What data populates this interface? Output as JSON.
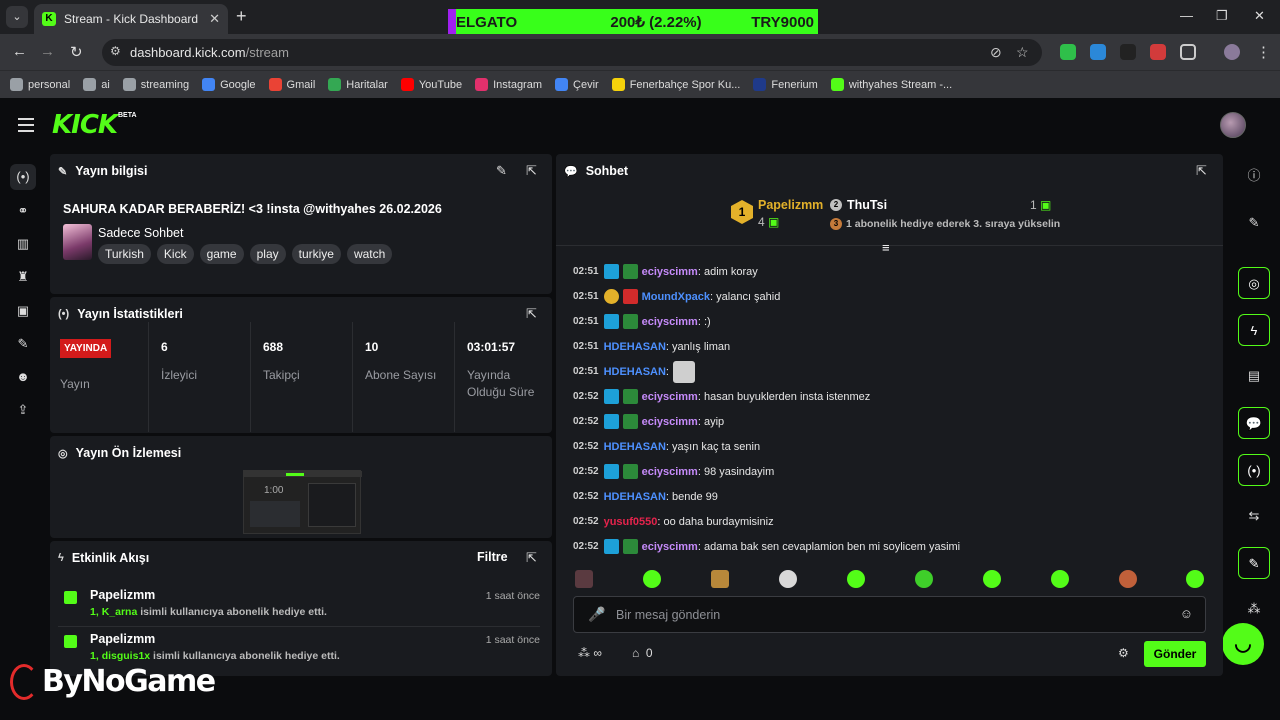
{
  "browser": {
    "tab_title": "Stream - Kick Dashboard",
    "url_host": "dashboard.kick.com",
    "url_path": "/stream",
    "ticker": {
      "left": "ELGATO",
      "mid": "200₺ (2.22%)",
      "right": "TRY9000"
    },
    "bookmarks": [
      {
        "label": "personal",
        "icon": "folder-icon",
        "color": "#9aa0a6"
      },
      {
        "label": "ai",
        "icon": "folder-icon",
        "color": "#9aa0a6"
      },
      {
        "label": "streaming",
        "icon": "folder-icon",
        "color": "#9aa0a6"
      },
      {
        "label": "Google",
        "icon": "google-icon",
        "color": "#4285f4"
      },
      {
        "label": "Gmail",
        "icon": "gmail-icon",
        "color": "#ea4335"
      },
      {
        "label": "Haritalar",
        "icon": "maps-icon",
        "color": "#34a853"
      },
      {
        "label": "YouTube",
        "icon": "youtube-icon",
        "color": "#ff0000"
      },
      {
        "label": "Instagram",
        "icon": "instagram-icon",
        "color": "#e1306c"
      },
      {
        "label": "Çevir",
        "icon": "translate-icon",
        "color": "#4285f4"
      },
      {
        "label": "Fenerbahçe Spor Ku...",
        "icon": "fenerbahce-icon",
        "color": "#f5d20b"
      },
      {
        "label": "Fenerium",
        "icon": "fenerium-icon",
        "color": "#1f3a8a"
      },
      {
        "label": "withyahes Stream -...",
        "icon": "kick-icon",
        "color": "#53fc18"
      }
    ]
  },
  "kick": {
    "logo": "KICK",
    "beta": "BETA"
  },
  "stream_info": {
    "heading": "Yayın bilgisi",
    "title": "SAHURA KADAR BERABERİZ! <3 !insta @withyahes 26.02.2026",
    "category": "Sadece Sohbet",
    "tags": [
      "Turkish",
      "Kick",
      "game",
      "play",
      "turkiye",
      "watch"
    ]
  },
  "stats": {
    "heading": "Yayın İstatistikleri",
    "live_badge": "YAYINDA",
    "live_label": "Yayın",
    "items": [
      {
        "value": "6",
        "label": "İzleyici"
      },
      {
        "value": "688",
        "label": "Takipçi"
      },
      {
        "value": "10",
        "label": "Abone Sayısı"
      },
      {
        "value": "03:01:57",
        "label": "Yayında",
        "label2": "Olduğu Süre"
      }
    ]
  },
  "preview": {
    "heading": "Yayın Ön İzlemesi",
    "time": "1:00"
  },
  "activity": {
    "heading": "Etkinlik Akışı",
    "filter": "Filtre",
    "events": [
      {
        "user": "Papelizmm",
        "count": "1,",
        "target": "K_arna",
        "text": " isimli kullanıcıya abonelik hediye etti.",
        "time": "1 saat önce"
      },
      {
        "user": "Papelizmm",
        "count": "1,",
        "target": "disguis1x",
        "text": " isimli kullanıcıya abonelik hediye etti.",
        "time": "1 saat önce"
      }
    ]
  },
  "chat": {
    "heading": "Sohbet",
    "pinned": {
      "first_rank": "1",
      "first_user": "Papelizmm",
      "first_count": "4",
      "second_rank": "2",
      "second_user": "ThuTsi",
      "second_count": "1",
      "third_rank": "3",
      "third_text": "1 abonelik hediye ederek 3. sıraya yükselin"
    },
    "messages": [
      {
        "time": "02:51",
        "badges": [
          "#1da0d8",
          "#2c8a3a"
        ],
        "user": "eciyscimm",
        "color": "#c58af9",
        "text": ": adim koray"
      },
      {
        "time": "02:51",
        "badges": [
          "gold",
          "#d12b2b"
        ],
        "user": "MoundXpack",
        "color": "#4d90fe",
        "text": ": yalancı şahid"
      },
      {
        "time": "02:51",
        "badges": [
          "#1da0d8",
          "#2c8a3a"
        ],
        "user": "eciyscimm",
        "color": "#c58af9",
        "text": ": :)"
      },
      {
        "time": "02:51",
        "badges": [],
        "user": "HDEHASAN",
        "color": "#4d90fe",
        "text": ": yanlış liman"
      },
      {
        "time": "02:51",
        "badges": [],
        "user": "HDEHASAN",
        "color": "#4d90fe",
        "text": ":",
        "emote": true
      },
      {
        "time": "02:52",
        "badges": [
          "#1da0d8",
          "#2c8a3a"
        ],
        "user": "eciyscimm",
        "color": "#c58af9",
        "text": ": hasan buyuklerden insta istenmez"
      },
      {
        "time": "02:52",
        "badges": [
          "#1da0d8",
          "#2c8a3a"
        ],
        "user": "eciyscimm",
        "color": "#c58af9",
        "text": ": ayip"
      },
      {
        "time": "02:52",
        "badges": [],
        "user": "HDEHASAN",
        "color": "#4d90fe",
        "text": ": yaşın kaç ta senin"
      },
      {
        "time": "02:52",
        "badges": [
          "#1da0d8",
          "#2c8a3a"
        ],
        "user": "eciyscimm",
        "color": "#c58af9",
        "text": ": 98 yasindayim"
      },
      {
        "time": "02:52",
        "badges": [],
        "user": "HDEHASAN",
        "color": "#4d90fe",
        "text": ": bende 99"
      },
      {
        "time": "02:52",
        "badges": [],
        "user": "yusuf0550",
        "color": "#e5234c",
        "text": ": oo daha burdaymisiniz"
      },
      {
        "time": "02:52",
        "badges": [
          "#1da0d8",
          "#2c8a3a"
        ],
        "user": "eciyscimm",
        "color": "#c58af9",
        "text": ": adama bak sen cevaplamion ben mi soylicem yasimi"
      }
    ],
    "placeholder": "Bir mesaj gönderin",
    "points": "∞",
    "followers_count": "0",
    "send": "Gönder"
  },
  "watermark": "ByNoGame"
}
